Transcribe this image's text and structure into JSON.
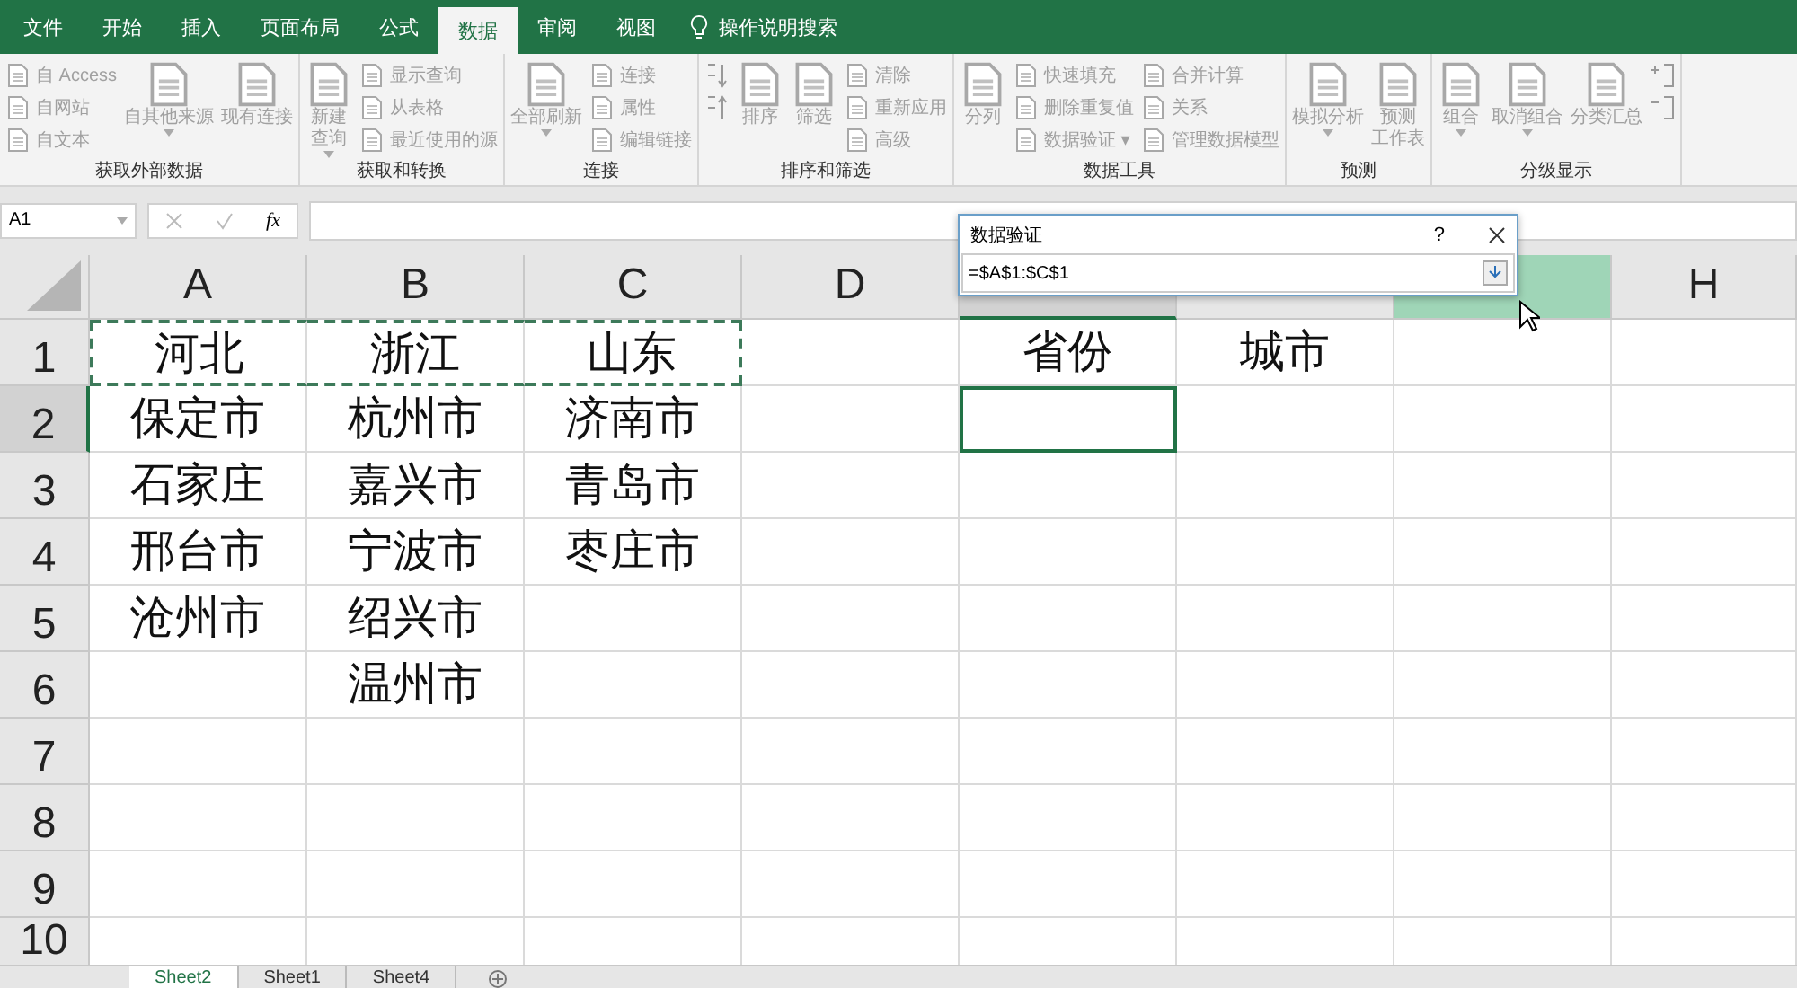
{
  "tabs": [
    {
      "label": "文件",
      "selected": false
    },
    {
      "label": "开始",
      "selected": false
    },
    {
      "label": "插入",
      "selected": false
    },
    {
      "label": "页面布局",
      "selected": false
    },
    {
      "label": "公式",
      "selected": false
    },
    {
      "label": "数据",
      "selected": true
    },
    {
      "label": "审阅",
      "selected": false
    },
    {
      "label": "视图",
      "selected": false
    }
  ],
  "tell_me": "操作说明搜索",
  "ribbon_groups": [
    {
      "label": "获取外部数据",
      "columns": [
        {
          "kind": "stack",
          "items": [
            "自 Access",
            "自网站",
            "自文本"
          ]
        },
        {
          "kind": "large",
          "lines": [
            "自其他来源"
          ],
          "dropdown": true
        },
        {
          "kind": "large",
          "lines": [
            "现有连接"
          ],
          "dropdown": false
        }
      ]
    },
    {
      "label": "获取和转换",
      "columns": [
        {
          "kind": "large",
          "lines": [
            "新建",
            "查询"
          ],
          "dropdown": true
        },
        {
          "kind": "stack",
          "items": [
            "显示查询",
            "从表格",
            "最近使用的源"
          ]
        }
      ]
    },
    {
      "label": "连接",
      "columns": [
        {
          "kind": "large",
          "lines": [
            "全部刷新"
          ],
          "dropdown": true
        },
        {
          "kind": "stack",
          "items": [
            "连接",
            "属性",
            "编辑链接"
          ]
        }
      ]
    },
    {
      "label": "排序和筛选",
      "columns": [
        {
          "kind": "sort"
        },
        {
          "kind": "large",
          "lines": [
            "排序"
          ],
          "dropdown": false
        },
        {
          "kind": "large",
          "lines": [
            "筛选"
          ],
          "dropdown": false
        },
        {
          "kind": "stack",
          "items": [
            "清除",
            "重新应用",
            "高级"
          ]
        }
      ]
    },
    {
      "label": "数据工具",
      "columns": [
        {
          "kind": "large",
          "lines": [
            "分列"
          ],
          "dropdown": false
        },
        {
          "kind": "stack",
          "items": [
            "快速填充",
            "删除重复值",
            "数据验证 ▾"
          ]
        },
        {
          "kind": "stack",
          "items": [
            "合并计算",
            "关系",
            "管理数据模型"
          ]
        }
      ]
    },
    {
      "label": "预测",
      "columns": [
        {
          "kind": "large",
          "lines": [
            "模拟分析"
          ],
          "dropdown": true
        },
        {
          "kind": "large",
          "lines": [
            "预测",
            "工作表"
          ],
          "dropdown": false
        }
      ]
    },
    {
      "label": "分级显示",
      "columns": [
        {
          "kind": "large",
          "lines": [
            "组合"
          ],
          "dropdown": true
        },
        {
          "kind": "large",
          "lines": [
            "取消组合"
          ],
          "dropdown": true
        },
        {
          "kind": "large",
          "lines": [
            "分类汇总"
          ],
          "dropdown": false
        },
        {
          "kind": "plusminus"
        }
      ]
    }
  ],
  "formula_bar": {
    "name_box": "A1",
    "fx": "fx"
  },
  "dialog": {
    "title": "数据验证",
    "help": "?",
    "value": "=$A$1:$C$1"
  },
  "columns": [
    {
      "label": "A",
      "selected": false,
      "highlighted": false
    },
    {
      "label": "B",
      "selected": false,
      "highlighted": false
    },
    {
      "label": "C",
      "selected": false,
      "highlighted": false
    },
    {
      "label": "D",
      "selected": false,
      "highlighted": false
    },
    {
      "selected": true,
      "highlighted": false
    },
    {
      "selected": false,
      "highlighted": false
    },
    {
      "selected": false,
      "highlighted": true
    },
    {
      "label": "H",
      "selected": false,
      "highlighted": false
    }
  ],
  "rows": [
    {
      "label": "1",
      "selected": false,
      "cells": [
        {
          "text": "河北",
          "copied": true,
          "selected": false
        },
        {
          "text": "浙江",
          "copied": true,
          "selected": false
        },
        {
          "text": "山东",
          "copied": true,
          "selected": false
        },
        {
          "copied": false,
          "selected": false
        },
        {
          "text": "省份",
          "copied": false,
          "selected": false
        },
        {
          "text": "城市",
          "copied": false,
          "selected": false
        },
        {
          "copied": false,
          "selected": false
        },
        {
          "copied": false,
          "selected": false
        }
      ]
    },
    {
      "label": "2",
      "selected": true,
      "cells": [
        {
          "text": "保定市",
          "copied": false,
          "selected": false
        },
        {
          "text": "杭州市",
          "copied": false,
          "selected": false
        },
        {
          "text": "济南市",
          "copied": false,
          "selected": false
        },
        {
          "copied": false,
          "selected": false
        },
        {
          "copied": false,
          "selected": true
        },
        {
          "copied": false,
          "selected": false
        },
        {
          "copied": false,
          "selected": false
        },
        {
          "copied": false,
          "selected": false
        }
      ]
    },
    {
      "label": "3",
      "selected": false,
      "cells": [
        {
          "text": "石家庄",
          "copied": false,
          "selected": false
        },
        {
          "text": "嘉兴市",
          "copied": false,
          "selected": false
        },
        {
          "text": "青岛市",
          "copied": false,
          "selected": false
        },
        {
          "copied": false,
          "selected": false
        },
        {
          "copied": false,
          "selected": false
        },
        {
          "copied": false,
          "selected": false
        },
        {
          "copied": false,
          "selected": false
        },
        {
          "copied": false,
          "selected": false
        }
      ]
    },
    {
      "label": "4",
      "selected": false,
      "cells": [
        {
          "text": "邢台市",
          "copied": false,
          "selected": false
        },
        {
          "text": "宁波市",
          "copied": false,
          "selected": false
        },
        {
          "text": "枣庄市",
          "copied": false,
          "selected": false
        },
        {
          "copied": false,
          "selected": false
        },
        {
          "copied": false,
          "selected": false
        },
        {
          "copied": false,
          "selected": false
        },
        {
          "copied": false,
          "selected": false
        },
        {
          "copied": false,
          "selected": false
        }
      ]
    },
    {
      "label": "5",
      "selected": false,
      "cells": [
        {
          "text": "沧州市",
          "copied": false,
          "selected": false
        },
        {
          "text": "绍兴市",
          "copied": false,
          "selected": false
        },
        {
          "copied": false,
          "selected": false
        },
        {
          "copied": false,
          "selected": false
        },
        {
          "copied": false,
          "selected": false
        },
        {
          "copied": false,
          "selected": false
        },
        {
          "copied": false,
          "selected": false
        },
        {
          "copied": false,
          "selected": false
        }
      ]
    },
    {
      "label": "6",
      "selected": false,
      "cells": [
        {
          "copied": false,
          "selected": false
        },
        {
          "text": "温州市",
          "copied": false,
          "selected": false
        },
        {
          "copied": false,
          "selected": false
        },
        {
          "copied": false,
          "selected": false
        },
        {
          "copied": false,
          "selected": false
        },
        {
          "copied": false,
          "selected": false
        },
        {
          "copied": false,
          "selected": false
        },
        {
          "copied": false,
          "selected": false
        }
      ]
    },
    {
      "label": "7",
      "selected": false,
      "cells": [
        {
          "copied": false,
          "selected": false
        },
        {
          "copied": false,
          "selected": false
        },
        {
          "copied": false,
          "selected": false
        },
        {
          "copied": false,
          "selected": false
        },
        {
          "copied": false,
          "selected": false
        },
        {
          "copied": false,
          "selected": false
        },
        {
          "copied": false,
          "selected": false
        },
        {
          "copied": false,
          "selected": false
        }
      ]
    },
    {
      "label": "8",
      "selected": false,
      "cells": [
        {
          "copied": false,
          "selected": false
        },
        {
          "copied": false,
          "selected": false
        },
        {
          "copied": false,
          "selected": false
        },
        {
          "copied": false,
          "selected": false
        },
        {
          "copied": false,
          "selected": false
        },
        {
          "copied": false,
          "selected": false
        },
        {
          "copied": false,
          "selected": false
        },
        {
          "copied": false,
          "selected": false
        }
      ]
    },
    {
      "label": "9",
      "selected": false,
      "cells": [
        {
          "copied": false,
          "selected": false
        },
        {
          "copied": false,
          "selected": false
        },
        {
          "copied": false,
          "selected": false
        },
        {
          "copied": false,
          "selected": false
        },
        {
          "copied": false,
          "selected": false
        },
        {
          "copied": false,
          "selected": false
        },
        {
          "copied": false,
          "selected": false
        },
        {
          "copied": false,
          "selected": false
        }
      ]
    },
    {
      "label": "10",
      "selected": false,
      "cells": [
        {
          "copied": false,
          "selected": false
        },
        {
          "copied": false,
          "selected": false
        },
        {
          "copied": false,
          "selected": false
        },
        {
          "copied": false,
          "selected": false
        },
        {
          "copied": false,
          "selected": false
        },
        {
          "copied": false,
          "selected": false
        },
        {
          "copied": false,
          "selected": false
        },
        {
          "copied": false,
          "selected": false
        }
      ]
    }
  ],
  "sheets": [
    {
      "label": "Sheet2",
      "selected": true
    },
    {
      "label": "Sheet1",
      "selected": false
    },
    {
      "label": "Sheet4",
      "selected": false
    }
  ]
}
